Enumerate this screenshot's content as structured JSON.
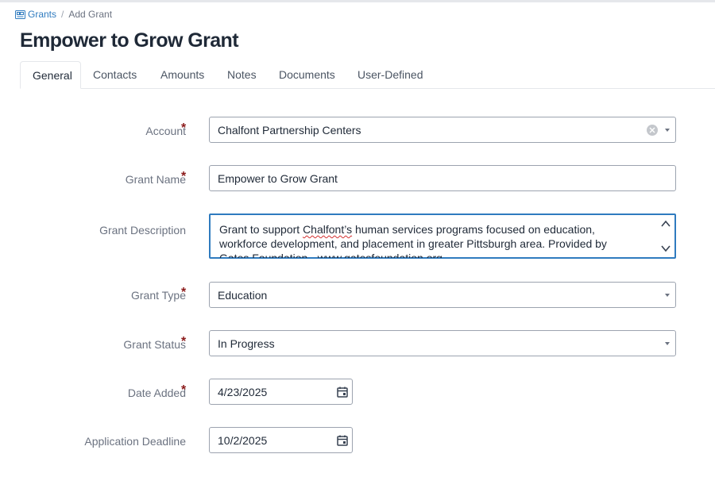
{
  "breadcrumb": {
    "root": "Grants",
    "separator": "/",
    "current": "Add Grant"
  },
  "title": "Empower to Grow Grant",
  "tabs": [
    {
      "label": "General",
      "active": true
    },
    {
      "label": "Contacts"
    },
    {
      "label": "Amounts"
    },
    {
      "label": "Notes"
    },
    {
      "label": "Documents"
    },
    {
      "label": "User-Defined"
    }
  ],
  "form": {
    "required_marker": "*",
    "account": {
      "label": "Account",
      "value": "Chalfont Partnership Centers"
    },
    "grant_name": {
      "label": "Grant Name",
      "value": "Empower to Grow Grant"
    },
    "grant_description": {
      "label": "Grant Description",
      "value_before": "Grant to support ",
      "value_flagged": "Chalfont’s",
      "value_after": " human services programs focused on education, workforce development, and placement in greater Pittsburgh area.  Provided by Gates Foundation - www.gatesfoundation.org"
    },
    "grant_type": {
      "label": "Grant Type",
      "value": "Education"
    },
    "grant_status": {
      "label": "Grant Status",
      "value": "In Progress"
    },
    "date_added": {
      "label": "Date Added",
      "value": "4/23/2025"
    },
    "application_deadline": {
      "label": "Application Deadline",
      "value": "10/2/2025"
    }
  },
  "colors": {
    "link": "#2f7bbf",
    "required": "#8b1a1a",
    "focus": "#2f7bbf"
  }
}
